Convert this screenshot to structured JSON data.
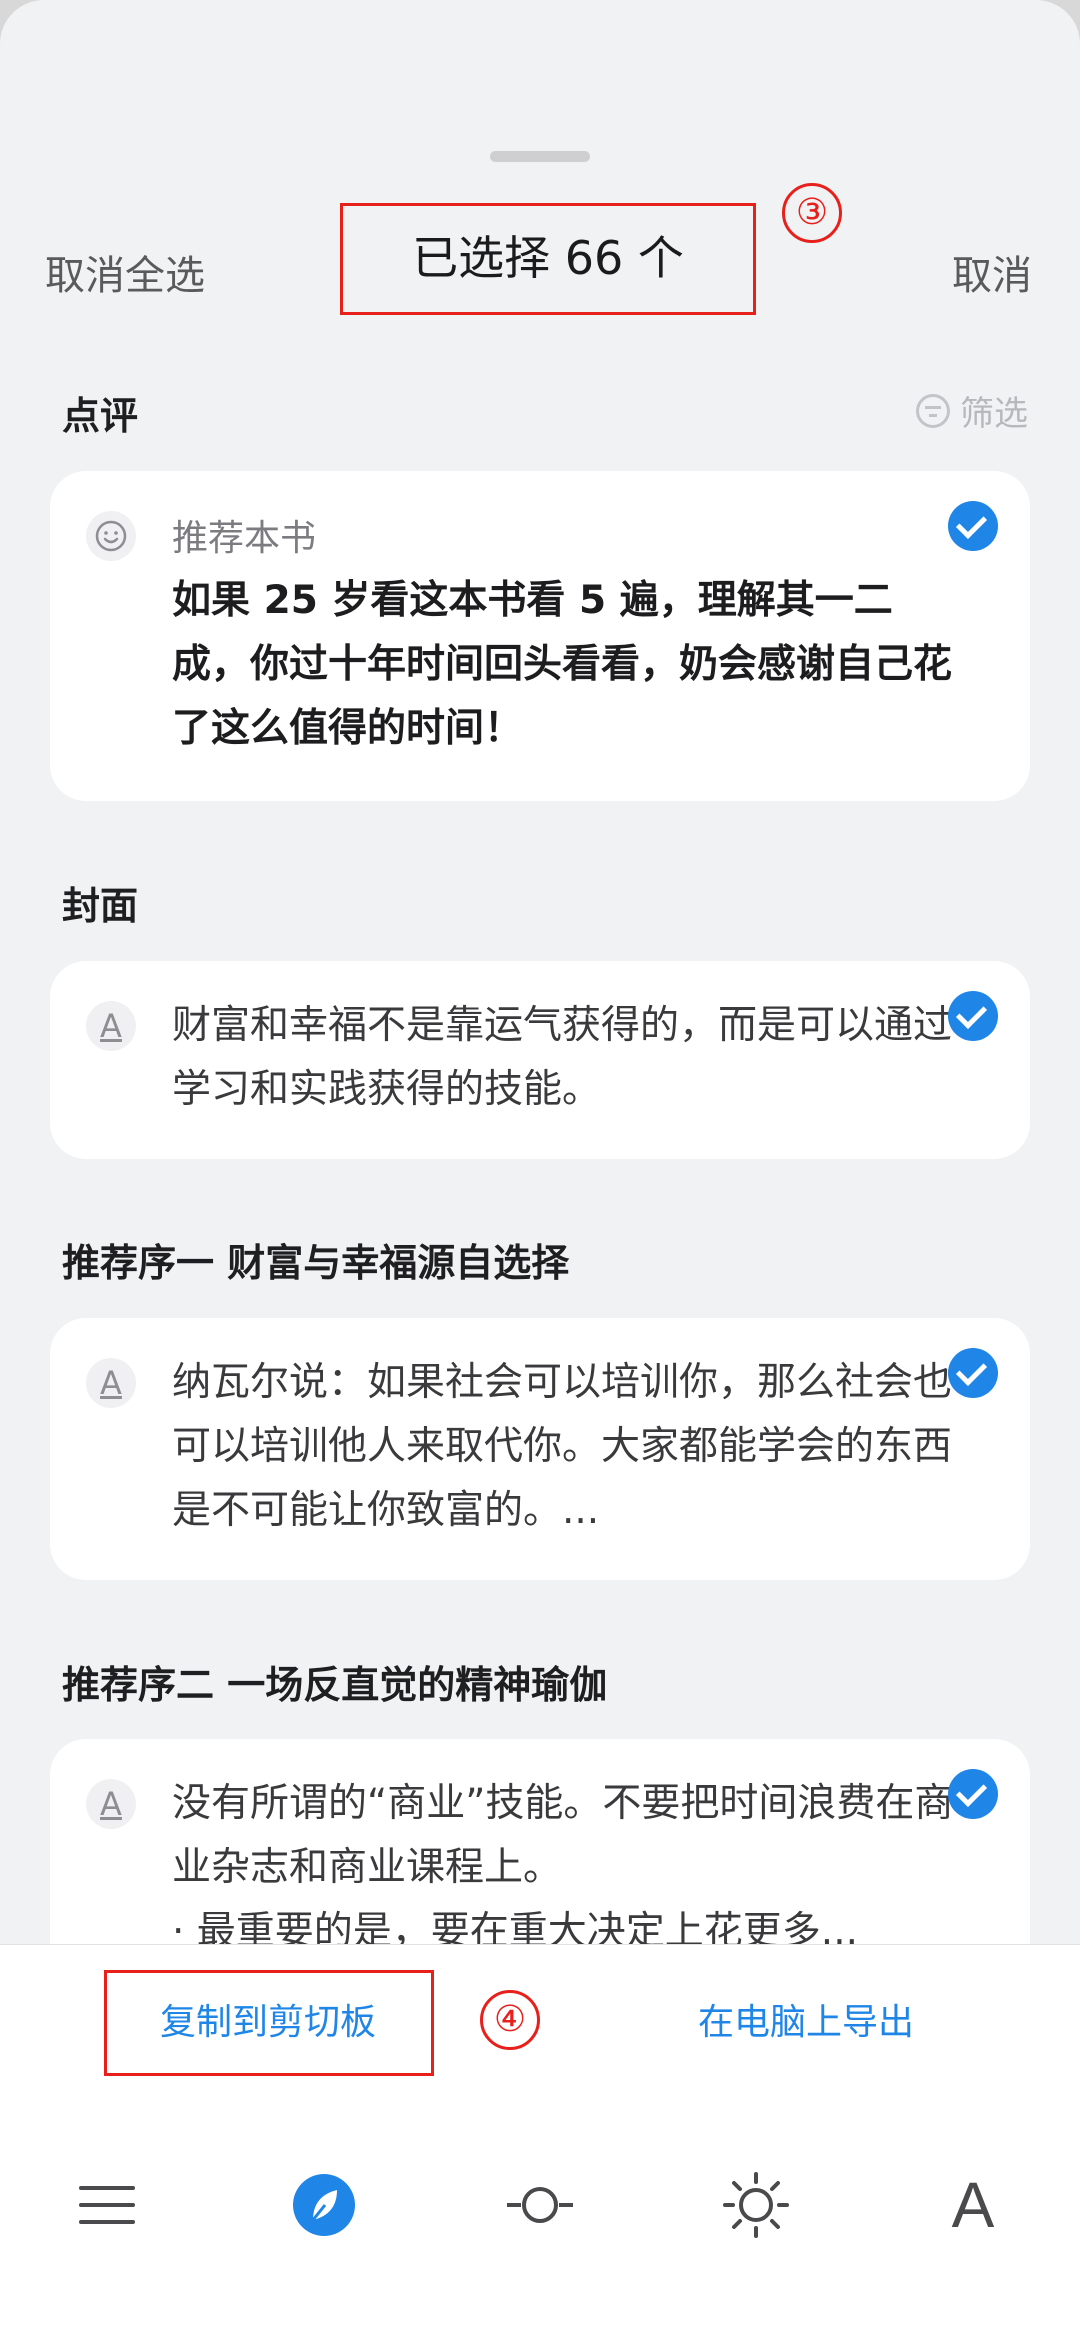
{
  "header": {
    "deselect_all": "取消全选",
    "title": "已选择 66 个",
    "cancel": "取消"
  },
  "annotations": {
    "marker_3": "③",
    "marker_4": "④"
  },
  "filter": {
    "label": "筛选",
    "icon": "filter-icon"
  },
  "sections": [
    {
      "title": "点评",
      "icon": "smiley-icon",
      "label": "推荐本书",
      "text": "如果 25 岁看这本书看 5 遍，理解其一二成，你过十年时间回头看看，奶会感谢自己花了这么值得的时间！",
      "checked": true
    },
    {
      "title": "封面",
      "icon": "underline-a-icon",
      "text": "财富和幸福不是靠运气获得的，而是可以通过学习和实践获得的技能。",
      "checked": true
    },
    {
      "title": "推荐序一 财富与幸福源自选择",
      "icon": "underline-a-icon",
      "text": "纳瓦尔说：如果社会可以培训你，那么社会也可以培训他人来取代你。大家都能学会的东西是不可能让你致富的。...",
      "checked": true
    },
    {
      "title": "推荐序二 一场反直觉的精神瑜伽",
      "icon": "underline-a-icon",
      "text": "没有所谓的“商业”技能。不要把时间浪费在商业杂志和商业课程上。",
      "text2": "· 最重要的是，要在重大决定上花更多...",
      "checked": true
    }
  ],
  "actions": {
    "copy": "复制到剪切板",
    "export": "在电脑上导出"
  },
  "bottom_nav": [
    {
      "icon": "menu-icon"
    },
    {
      "icon": "compass-icon",
      "active": true
    },
    {
      "icon": "progress-slider-icon"
    },
    {
      "icon": "brightness-icon"
    },
    {
      "icon": "font-icon",
      "glyph": "A"
    }
  ],
  "colors": {
    "accent": "#1f86e8",
    "annotation_red": "#e8201c",
    "background": "#f1f2f4"
  }
}
